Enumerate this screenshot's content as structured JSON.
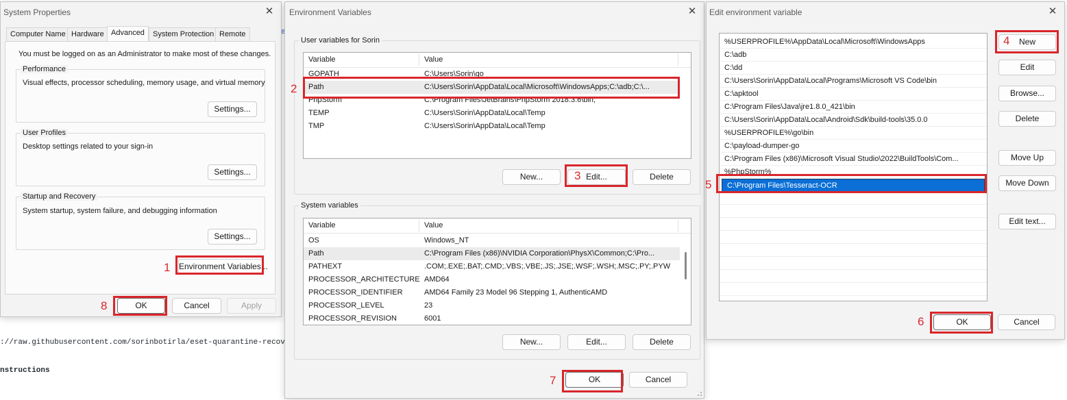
{
  "background": {
    "url_fragment": "://raw.githubusercontent.com/sorinbotirla/eset-quarantine-recov",
    "instructions": "nstructions"
  },
  "system_properties": {
    "title": "System Properties",
    "tabs": [
      "Computer Name",
      "Hardware",
      "Advanced",
      "System Protection",
      "Remote"
    ],
    "active_tab": "Advanced",
    "admin_note": "You must be logged on as an Administrator to make most of these changes.",
    "performance": {
      "label": "Performance",
      "desc": "Visual effects, processor scheduling, memory usage, and virtual memory",
      "button": "Settings..."
    },
    "user_profiles": {
      "label": "User Profiles",
      "desc": "Desktop settings related to your sign-in",
      "button": "Settings..."
    },
    "startup_recovery": {
      "label": "Startup and Recovery",
      "desc": "System startup, system failure, and debugging information",
      "button": "Settings..."
    },
    "env_button": "Environment Variables...",
    "ok": "OK",
    "cancel": "Cancel",
    "apply": "Apply"
  },
  "environment_variables": {
    "title": "Environment Variables",
    "user_group": "User variables for Sorin",
    "columns": [
      "Variable",
      "Value"
    ],
    "user_rows": [
      {
        "variable": "GOPATH",
        "value": "C:\\Users\\Sorin\\go"
      },
      {
        "variable": "Path",
        "value": "C:\\Users\\Sorin\\AppData\\Local\\Microsoft\\WindowsApps;C:\\adb;C:\\..."
      },
      {
        "variable": "PhpStorm",
        "value": "C:\\Program Files\\JetBrains\\PhpStorm 2018.3.6\\bin;"
      },
      {
        "variable": "TEMP",
        "value": "C:\\Users\\Sorin\\AppData\\Local\\Temp"
      },
      {
        "variable": "TMP",
        "value": "C:\\Users\\Sorin\\AppData\\Local\\Temp"
      }
    ],
    "user_buttons": {
      "new": "New...",
      "edit": "Edit...",
      "delete": "Delete"
    },
    "system_group": "System variables",
    "system_rows": [
      {
        "variable": "OS",
        "value": "Windows_NT"
      },
      {
        "variable": "Path",
        "value": "C:\\Program Files (x86)\\NVIDIA Corporation\\PhysX\\Common;C:\\Pro..."
      },
      {
        "variable": "PATHEXT",
        "value": ".COM;.EXE;.BAT;.CMD;.VBS;.VBE;.JS;.JSE;.WSF;.WSH;.MSC;.PY;.PYW"
      },
      {
        "variable": "PROCESSOR_ARCHITECTURE",
        "value": "AMD64"
      },
      {
        "variable": "PROCESSOR_IDENTIFIER",
        "value": "AMD64 Family 23 Model 96 Stepping 1, AuthenticAMD"
      },
      {
        "variable": "PROCESSOR_LEVEL",
        "value": "23"
      },
      {
        "variable": "PROCESSOR_REVISION",
        "value": "6001"
      }
    ],
    "system_buttons": {
      "new": "New...",
      "edit": "Edit...",
      "delete": "Delete"
    },
    "ok": "OK",
    "cancel": "Cancel"
  },
  "edit_env_var": {
    "title": "Edit environment variable",
    "paths": [
      "%USERPROFILE%\\AppData\\Local\\Microsoft\\WindowsApps",
      "C:\\adb",
      "C:\\dd",
      "C:\\Users\\Sorin\\AppData\\Local\\Programs\\Microsoft VS Code\\bin",
      "C:\\apktool",
      "C:\\Program Files\\Java\\jre1.8.0_421\\bin",
      "C:\\Users\\Sorin\\AppData\\Local\\Android\\Sdk\\build-tools\\35.0.0",
      "%USERPROFILE%\\go\\bin",
      "C:\\payload-dumper-go",
      "C:\\Program Files (x86)\\Microsoft Visual Studio\\2022\\BuildTools\\Com...",
      "%PhpStorm%",
      "C:\\Program Files\\Tesseract-OCR"
    ],
    "selected_index": 11,
    "buttons": {
      "new": "New",
      "edit": "Edit",
      "browse": "Browse...",
      "delete": "Delete",
      "move_up": "Move Up",
      "move_down": "Move Down",
      "edit_text": "Edit text..."
    },
    "ok": "OK",
    "cancel": "Cancel"
  },
  "steps": [
    "1",
    "2",
    "3",
    "4",
    "5",
    "6",
    "7",
    "8"
  ],
  "colors": {
    "highlight": "#d9262b",
    "selection": "#0b6fd6",
    "dialog_bg": "#f3f3f3"
  }
}
